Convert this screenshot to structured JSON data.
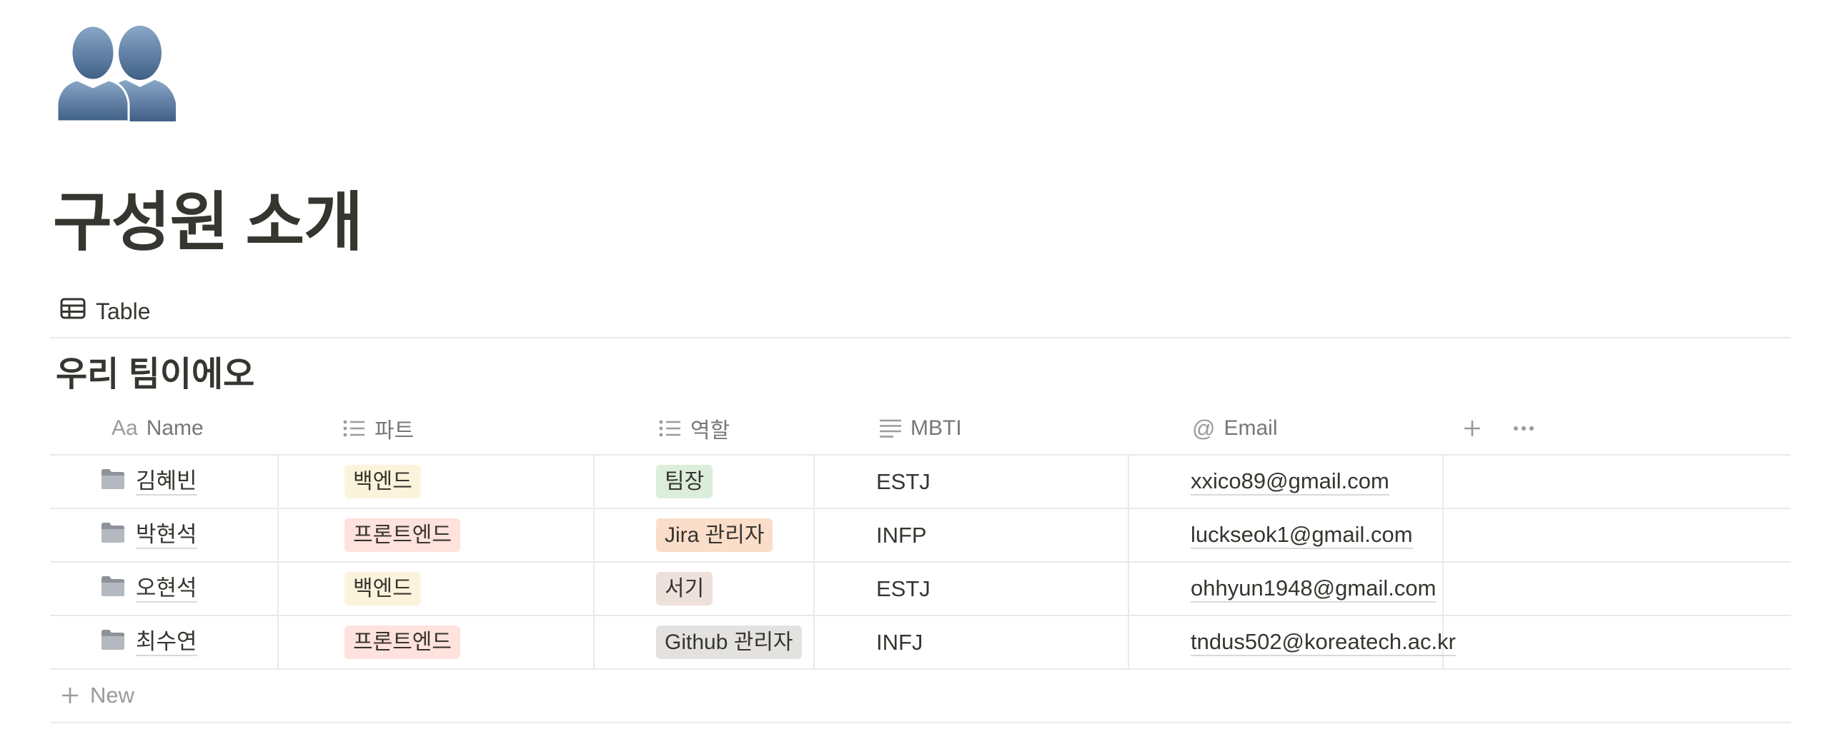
{
  "page": {
    "icon": "two-people-silhouette-icon",
    "title": "구성원 소개"
  },
  "view": {
    "tab_label": "Table",
    "tab_icon": "table-icon"
  },
  "database": {
    "title": "우리 팀이에오",
    "columns": [
      {
        "label": "Name",
        "icon": "Aa"
      },
      {
        "label": "파트",
        "icon": "list-icon"
      },
      {
        "label": "역할",
        "icon": "list-icon"
      },
      {
        "label": "MBTI",
        "icon": "text-lines-icon"
      },
      {
        "label": "Email",
        "icon": "@"
      }
    ],
    "add_column": "+",
    "more": "···",
    "rows": [
      {
        "name": "김혜빈",
        "part": {
          "label": "백엔드",
          "color": "#fbf3db"
        },
        "role": {
          "label": "팀장",
          "color": "#dbeddb"
        },
        "mbti": "ESTJ",
        "email": "xxico89@gmail.com"
      },
      {
        "name": "박현석",
        "part": {
          "label": "프론트엔드",
          "color": "#ffe2dd"
        },
        "role": {
          "label": "Jira 관리자",
          "color": "#fadec9"
        },
        "mbti": "INFP",
        "email": "luckseok1@gmail.com"
      },
      {
        "name": "오현석",
        "part": {
          "label": "백엔드",
          "color": "#fbf3db"
        },
        "role": {
          "label": "서기",
          "color": "#eee0da"
        },
        "mbti": "ESTJ",
        "email": "ohhyun1948@gmail.com"
      },
      {
        "name": "최수연",
        "part": {
          "label": "프론트엔드",
          "color": "#ffe2dd"
        },
        "role": {
          "label": "Github 관리자",
          "color": "#e3e2e0"
        },
        "mbti": "INFJ",
        "email": "tndus502@koreatech.ac.kr"
      }
    ],
    "new_label": "New"
  }
}
